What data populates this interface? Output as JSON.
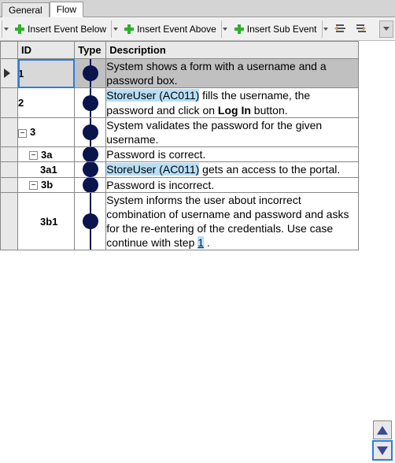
{
  "tabs": {
    "general": "General",
    "flow": "Flow"
  },
  "toolbar": {
    "insert_below": "Insert Event Below",
    "insert_above": "Insert Event Above",
    "insert_sub": "Insert Sub Event"
  },
  "columns": {
    "id": "ID",
    "type": "Type",
    "description": "Description"
  },
  "rows": [
    {
      "id": "1",
      "indent": 0,
      "expander": "",
      "selected": true,
      "parts": [
        {
          "t": "System shows a form with a username and a password box."
        }
      ]
    },
    {
      "id": "2",
      "indent": 0,
      "expander": "",
      "selected": false,
      "parts": [
        {
          "t": "StoreUser (AC011)",
          "cls": "hl"
        },
        {
          "t": " fills the username, the password and click on "
        },
        {
          "t": "Log In",
          "cls": "bold"
        },
        {
          "t": " button."
        }
      ]
    },
    {
      "id": "3",
      "indent": 0,
      "expander": "−",
      "selected": false,
      "parts": [
        {
          "t": "System validates the password for the given username."
        }
      ]
    },
    {
      "id": "3a",
      "indent": 1,
      "expander": "−",
      "selected": false,
      "parts": [
        {
          "t": "Password is correct."
        }
      ]
    },
    {
      "id": "3a1",
      "indent": 2,
      "expander": "",
      "selected": false,
      "parts": [
        {
          "t": "StoreUser (AC011)",
          "cls": "hl"
        },
        {
          "t": " gets an access to the portal."
        }
      ]
    },
    {
      "id": "3b",
      "indent": 1,
      "expander": "−",
      "selected": false,
      "parts": [
        {
          "t": "Password is incorrect."
        }
      ]
    },
    {
      "id": "3b1",
      "indent": 2,
      "expander": "",
      "selected": false,
      "parts": [
        {
          "t": "System informs the user about incorrect combination of username and password and asks for the re-entering of the credentials. Use case continue with step "
        },
        {
          "t": "1",
          "cls": "link"
        },
        {
          "t": " ."
        }
      ]
    }
  ]
}
